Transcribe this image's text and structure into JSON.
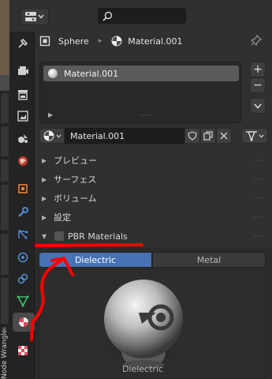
{
  "header": {
    "editor_type_icon": "properties-editor-icon",
    "search_icon": "search-icon"
  },
  "breadcrumb": {
    "object_icon": "object-icon",
    "object_name": "Sphere",
    "separator": "▸",
    "material_icon": "material-icon",
    "material_name": "Material.001",
    "pin_icon": "pin-icon"
  },
  "property_tabs": [
    {
      "name": "tool-tab",
      "icon": "tool-icon"
    },
    {
      "name": "render-tab",
      "icon": "render-icon"
    },
    {
      "name": "output-tab",
      "icon": "output-icon"
    },
    {
      "name": "view-layer-tab",
      "icon": "view-layer-icon"
    },
    {
      "name": "scene-tab",
      "icon": "scene-icon"
    },
    {
      "name": "world-tab",
      "icon": "world-icon"
    },
    {
      "name": "object-tab",
      "icon": "object-icon"
    },
    {
      "name": "modifier-tab",
      "icon": "wrench-icon"
    },
    {
      "name": "particles-tab",
      "icon": "particles-icon"
    },
    {
      "name": "physics-tab",
      "icon": "physics-icon"
    },
    {
      "name": "constraints-tab",
      "icon": "constraints-icon"
    },
    {
      "name": "data-tab",
      "icon": "mesh-data-icon"
    },
    {
      "name": "material-tab",
      "icon": "material-icon",
      "active": true
    },
    {
      "name": "texture-tab",
      "icon": "texture-icon"
    }
  ],
  "left_sidebar": {
    "vertical_tab_label": "Node Wrangler"
  },
  "material_slots": {
    "items": [
      {
        "label": "Material.001",
        "selected": true
      }
    ],
    "add_icon": "+",
    "remove_icon": "−",
    "menu_icon": "chevron-down-icon"
  },
  "material_datablock": {
    "name": "Material.001",
    "fake_user_icon": "shield-icon",
    "duplicate_icon": "duplicate-icon",
    "unlink_icon": "close-icon"
  },
  "panels": [
    {
      "title": "プレビュー",
      "expanded": false
    },
    {
      "title": "サーフェス",
      "expanded": false
    },
    {
      "title": "ボリューム",
      "expanded": false
    },
    {
      "title": "設定",
      "expanded": false
    },
    {
      "title": "PBR Materials",
      "expanded": true,
      "checkbox": false
    }
  ],
  "pbr": {
    "tabs": [
      {
        "label": "Dielectric",
        "active": true
      },
      {
        "label": "Metal",
        "active": false
      }
    ],
    "preview_caption": "Dielectric"
  },
  "colors": {
    "accent": "#4772b3",
    "annotation": "#ff0000"
  }
}
